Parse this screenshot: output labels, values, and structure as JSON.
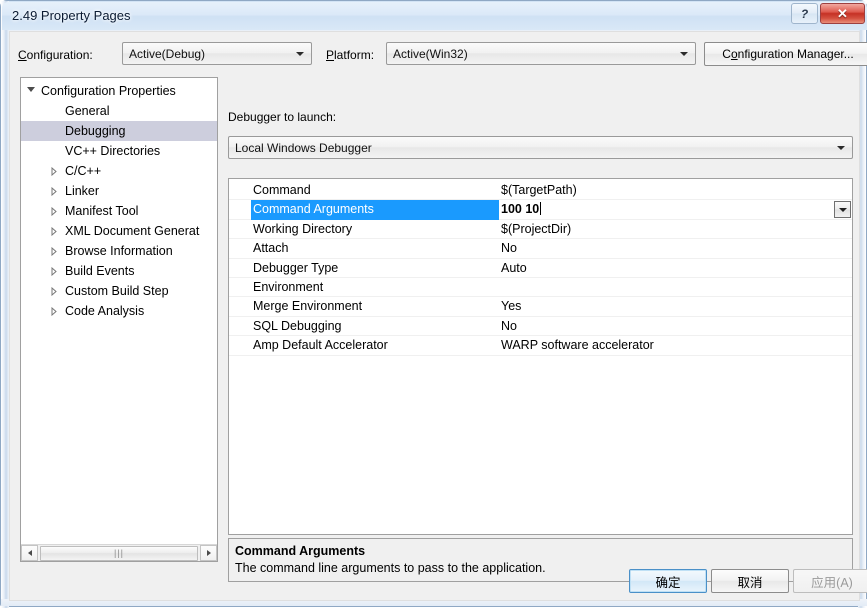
{
  "window": {
    "title": "2.49 Property Pages",
    "help_button": "?",
    "close_button": "✕",
    "help_icon": "question-mark-icon",
    "close_icon": "close-x-icon"
  },
  "config_bar": {
    "configuration_label": "Configuration:",
    "configuration_label_mnemonic": "C",
    "configuration_value": "Active(Debug)",
    "platform_label": "Platform:",
    "platform_label_mnemonic": "P",
    "platform_value": "Active(Win32)",
    "configuration_manager_button": "Configuration Manager...",
    "configuration_manager_mnemonic": "o"
  },
  "tree": {
    "items": [
      {
        "label": "Configuration Properties",
        "level": 0,
        "expander": "expanded",
        "selected": false
      },
      {
        "label": "General",
        "level": 1,
        "expander": "none",
        "selected": false
      },
      {
        "label": "Debugging",
        "level": 1,
        "expander": "none",
        "selected": true
      },
      {
        "label": "VC++ Directories",
        "level": 1,
        "expander": "none",
        "selected": false
      },
      {
        "label": "C/C++",
        "level": 1,
        "expander": "collapsed",
        "selected": false
      },
      {
        "label": "Linker",
        "level": 1,
        "expander": "collapsed",
        "selected": false
      },
      {
        "label": "Manifest Tool",
        "level": 1,
        "expander": "collapsed",
        "selected": false
      },
      {
        "label": "XML Document Generat",
        "level": 1,
        "expander": "collapsed",
        "selected": false
      },
      {
        "label": "Browse Information",
        "level": 1,
        "expander": "collapsed",
        "selected": false
      },
      {
        "label": "Build Events",
        "level": 1,
        "expander": "collapsed",
        "selected": false
      },
      {
        "label": "Custom Build Step",
        "level": 1,
        "expander": "collapsed",
        "selected": false
      },
      {
        "label": "Code Analysis",
        "level": 1,
        "expander": "collapsed",
        "selected": false
      }
    ],
    "scrollbar": {
      "left_arrow_icon": "chevron-left-icon",
      "right_arrow_icon": "chevron-right-icon",
      "thumb_grip": "⦙⦙⦙"
    }
  },
  "main": {
    "debugger_label": "Debugger to launch:",
    "debugger_value": "Local Windows Debugger",
    "properties": [
      {
        "name": "Command",
        "value": "$(TargetPath)",
        "selected": false,
        "editing": false
      },
      {
        "name": "Command Arguments",
        "value": "100 10",
        "selected": true,
        "editing": true
      },
      {
        "name": "Working Directory",
        "value": "$(ProjectDir)",
        "selected": false,
        "editing": false
      },
      {
        "name": "Attach",
        "value": "No",
        "selected": false,
        "editing": false
      },
      {
        "name": "Debugger Type",
        "value": "Auto",
        "selected": false,
        "editing": false
      },
      {
        "name": "Environment",
        "value": "",
        "selected": false,
        "editing": false
      },
      {
        "name": "Merge Environment",
        "value": "Yes",
        "selected": false,
        "editing": false
      },
      {
        "name": "SQL Debugging",
        "value": "No",
        "selected": false,
        "editing": false
      },
      {
        "name": "Amp Default Accelerator",
        "value": "WARP software accelerator",
        "selected": false,
        "editing": false
      }
    ]
  },
  "description": {
    "title": "Command Arguments",
    "body": "The command line arguments to pass to the application."
  },
  "buttons": {
    "ok": "确定",
    "cancel": "取消",
    "apply": "应用(A)"
  },
  "colors": {
    "selection_blue": "#1a9afe",
    "tree_selection": "#cdcedd",
    "titlebar": "#d5e5f5",
    "close_red": "#c53125",
    "dialog_bg": "#f0f0f0"
  }
}
